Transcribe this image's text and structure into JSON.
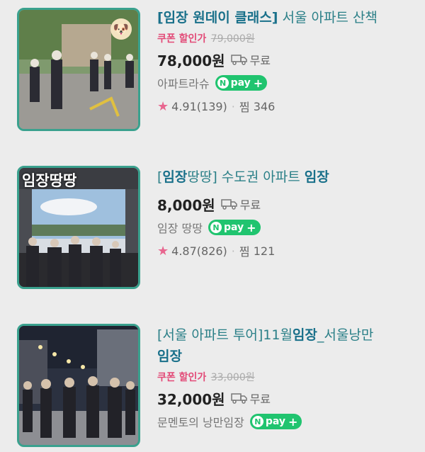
{
  "colors": {
    "accent_title": "#2a7f87",
    "coupon": "#e24a77",
    "npay": "#20c46f",
    "star": "#e8668f"
  },
  "products": [
    {
      "title_prefix": "[임장 원데이 클래스]",
      "title_rest": " 서울 아파트 산책",
      "coupon_label": "쿠폰 할인가",
      "original_price": "79,000원",
      "price": "78,000원",
      "shipping": "무료",
      "seller": "아파트라슈",
      "npay": "pay",
      "rating": "4.91",
      "review_count": "(139)",
      "wish_label": "찜",
      "wish_count": "346",
      "icon": "dog-sticker-icon"
    },
    {
      "thumb_text": "임장땅땅",
      "title_p1": "[",
      "title_hl1": "임장",
      "title_p2": "땅땅] 수도권 아파트 ",
      "title_hl2": "임장",
      "price": "8,000원",
      "shipping": "무료",
      "seller": "임장 땅땅",
      "npay": "pay",
      "rating": "4.87",
      "review_count": "(826)",
      "wish_label": "찜",
      "wish_count": "121"
    },
    {
      "title_p1": "[서울 아파트 투어]11월",
      "title_hl1": "임장",
      "title_p2": "_서울낭만",
      "title_hl2": "임장",
      "coupon_label": "쿠폰 할인가",
      "original_price": "33,000원",
      "price": "32,000원",
      "shipping": "무료",
      "seller": "문멘토의 낭만임장",
      "npay": "pay"
    }
  ]
}
